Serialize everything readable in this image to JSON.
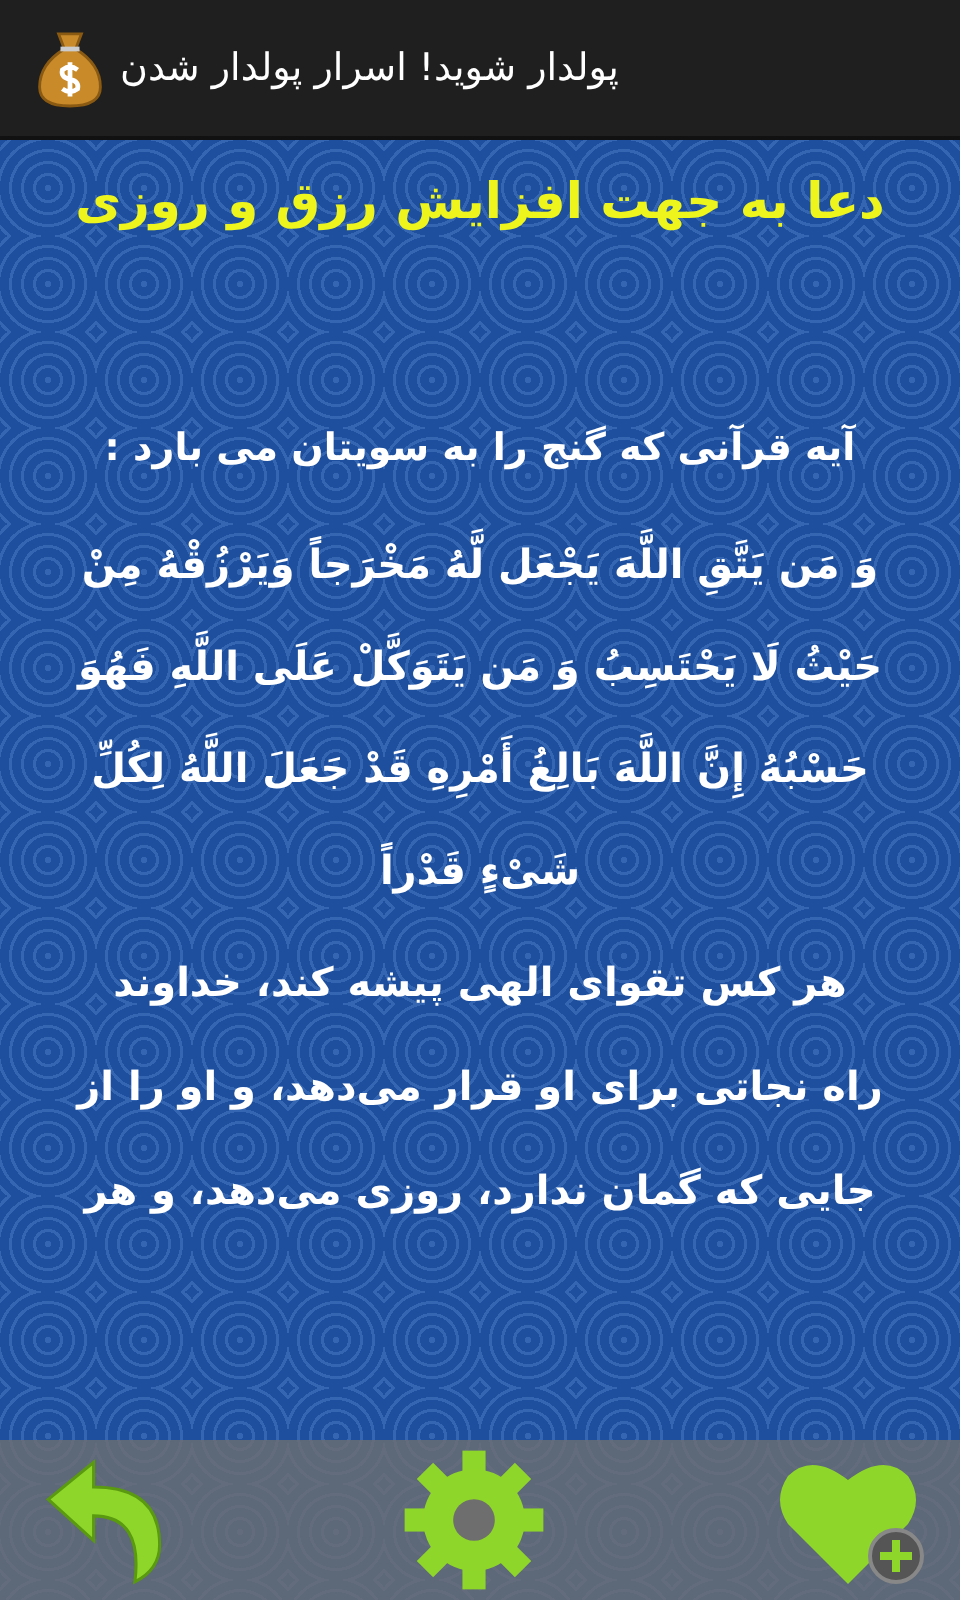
{
  "action_bar": {
    "title": "پولدار شوید! اسرار پولدار شدن"
  },
  "heading": "دعا به جهت افزایش رزق و روزی",
  "intro": "آیه قرآنی که گنج را به سویتان می بارد :",
  "verse_lines": [
    "وَ مَن یَتَّقِ اللَّهَ یَجْعَل لَّهُ مَخْرَجاً وَیَرْزُقْهُ مِنْ",
    "حَیْثُ لَا یَحْتَسِبُ وَ مَن یَتَوَکَّلْ عَلَى اللَّهِ فَهُوَ",
    "حَسْبُهُ إِنَّ اللَّهَ بَالِغُ أَمْرِهِ قَدْ جَعَلَ اللَّهُ لِکُلِّ",
    "شَیْءٍ قَدْراً"
  ],
  "translation_lines": [
    "هر کس تقوای الهی پیشه کند، خداوند",
    "راه نجاتی برای او قرار می‌دهد، و او را از",
    "جایی که گمان ندارد، روزی می‌دهد، و هر"
  ],
  "bottom_bar": [
    {
      "kind": "back"
    },
    {
      "kind": "settings"
    },
    {
      "kind": "favorite"
    }
  ]
}
